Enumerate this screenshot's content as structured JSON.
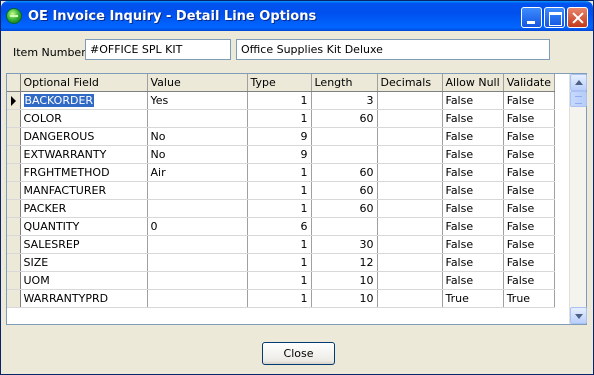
{
  "window": {
    "title": "OE Invoice Inquiry - Detail Line Options"
  },
  "item": {
    "label": "Item Number",
    "number": "#OFFICE SPL KIT",
    "description": "Office Supplies Kit Deluxe"
  },
  "grid": {
    "columns": [
      "Optional Field",
      "Value",
      "Type",
      "Length",
      "Decimals",
      "Allow Null",
      "Validate"
    ],
    "selected_row": 0,
    "rows": [
      [
        "BACKORDER",
        "Yes",
        "1",
        "3",
        "",
        "False",
        "False"
      ],
      [
        "COLOR",
        "",
        "1",
        "60",
        "",
        "False",
        "False"
      ],
      [
        "DANGEROUS",
        "No",
        "9",
        "",
        "",
        "False",
        "False"
      ],
      [
        "EXTWARRANTY",
        "No",
        "9",
        "",
        "",
        "False",
        "False"
      ],
      [
        "FRGHTMETHOD",
        "Air",
        "1",
        "60",
        "",
        "False",
        "False"
      ],
      [
        "MANFACTURER",
        "",
        "1",
        "60",
        "",
        "False",
        "False"
      ],
      [
        "PACKER",
        "",
        "1",
        "60",
        "",
        "False",
        "False"
      ],
      [
        "QUANTITY",
        "0",
        "6",
        "",
        "",
        "False",
        "False"
      ],
      [
        "SALESREP",
        "",
        "1",
        "30",
        "",
        "False",
        "False"
      ],
      [
        "SIZE",
        "",
        "1",
        "12",
        "",
        "False",
        "False"
      ],
      [
        "UOM",
        "",
        "1",
        "10",
        "",
        "False",
        "False"
      ],
      [
        "WARRANTYPRD",
        "",
        "1",
        "10",
        "",
        "True",
        "True"
      ]
    ]
  },
  "buttons": {
    "close": "Close"
  }
}
